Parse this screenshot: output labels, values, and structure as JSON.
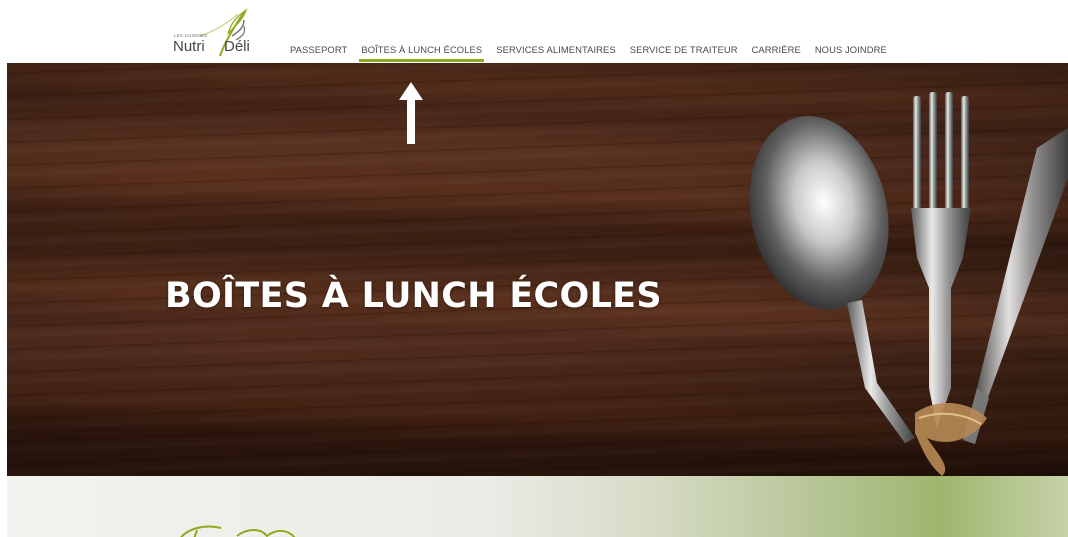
{
  "brand": {
    "logo_small": "LES CUISINES",
    "logo_name_left": "Nutri",
    "logo_name_right": "Déli",
    "accent_color": "#8cab1f"
  },
  "nav": {
    "items": [
      {
        "label": "PASSEPORT",
        "active": false
      },
      {
        "label": "BOÎTES À LUNCH ÉCOLES",
        "active": true
      },
      {
        "label": "SERVICES ALIMENTAIRES",
        "active": false
      },
      {
        "label": "SERVICE DE TRAITEUR",
        "active": false
      },
      {
        "label": "CARRIÈRE",
        "active": false
      },
      {
        "label": "NOUS JOINDRE",
        "active": false
      }
    ]
  },
  "hero": {
    "title": "BOÎTES À LUNCH ÉCOLES",
    "scroll_icon": "arrow-up-icon",
    "image_subject": "cutlery-icon"
  }
}
